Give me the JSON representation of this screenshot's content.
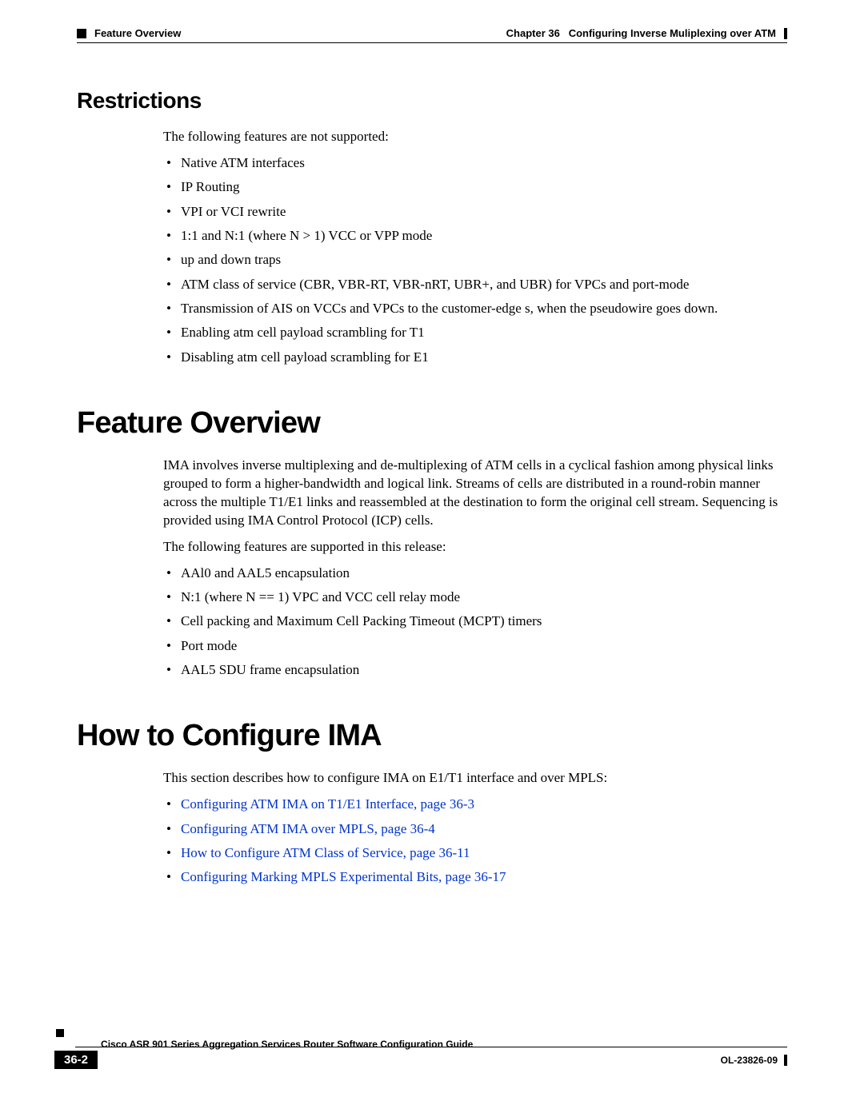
{
  "header": {
    "left_section": "Feature Overview",
    "chapter_label": "Chapter 36",
    "chapter_title": "Configuring Inverse Muliplexing over ATM"
  },
  "restrictions": {
    "heading": "Restrictions",
    "intro": "The following features are not supported:",
    "items": [
      "Native ATM interfaces",
      "IP Routing",
      "VPI or VCI rewrite",
      "1:1 and N:1 (where N > 1) VCC or VPP mode",
      "up and down traps",
      "ATM class of service (CBR, VBR-RT, VBR-nRT, UBR+, and UBR) for VPCs and port-mode",
      "Transmission of AIS on VCCs and VPCs to the customer-edge s, when the pseudowire goes down.",
      "Enabling atm cell payload scrambling for T1",
      "Disabling atm cell payload scrambling for E1"
    ]
  },
  "feature_overview": {
    "heading": "Feature Overview",
    "para1": "IMA involves inverse multiplexing and de-multiplexing of ATM cells in a cyclical fashion among physical links grouped to form a higher-bandwidth and logical link. Streams of cells are distributed in a round-robin manner across the multiple T1/E1 links and reassembled at the destination to form the original cell stream. Sequencing is provided using IMA Control Protocol (ICP) cells.",
    "para2": "The following features are supported in this release:",
    "items": [
      "AAl0 and AAL5 encapsulation",
      "N:1 (where N == 1) VPC and VCC cell relay mode",
      "Cell packing and Maximum Cell Packing Timeout (MCPT) timers",
      "Port mode",
      "AAL5 SDU frame encapsulation"
    ]
  },
  "how_to": {
    "heading": "How to Configure IMA",
    "intro": "This section describes how to configure IMA on E1/T1 interface and over MPLS:",
    "links": [
      "Configuring ATM IMA on T1/E1 Interface, page 36-3",
      "Configuring ATM IMA over MPLS, page 36-4",
      "How to Configure ATM Class of Service, page 36-11",
      "Configuring Marking MPLS Experimental Bits, page 36-17"
    ]
  },
  "footer": {
    "doc_title": "Cisco ASR 901 Series Aggregation Services Router Software Configuration Guide",
    "page_num": "36-2",
    "doc_id": "OL-23826-09"
  }
}
